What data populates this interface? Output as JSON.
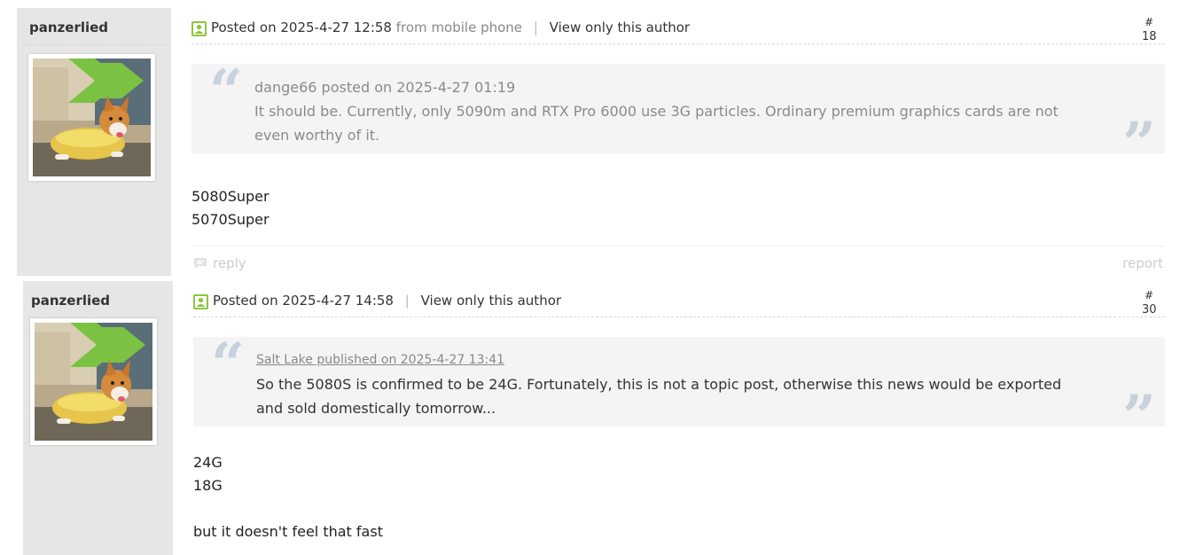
{
  "posts": [
    {
      "author": "panzerlied",
      "posted": "Posted on 2025-4-27 12:58",
      "from": "from mobile phone",
      "separator": "|",
      "view_only": "View only this author",
      "floor_mark": "#",
      "floor_num": "18",
      "quote": {
        "source": "dange66 posted on 2025-4-27 01:19",
        "text": "It should be. Currently, only 5090m and RTX Pro 6000 use 3G particles. Ordinary premium graphics cards are not even worthy of it."
      },
      "body_lines": [
        "5080Super",
        "5070Super"
      ],
      "reply": "reply",
      "report": "report"
    },
    {
      "author": "panzerlied",
      "posted": "Posted on 2025-4-27 14:58",
      "separator": "|",
      "view_only": "View only this author",
      "floor_mark": "#",
      "floor_num": "30",
      "quote": {
        "source": "Salt Lake published on 2025-4-27 13:41",
        "text": "So the 5080S is confirmed to be 24G. Fortunately, this is not a topic post, otherwise this news would be exported and sold domestically tomorrow..."
      },
      "body_lines": [
        "24G",
        "18G",
        "",
        "but it doesn't feel that fast"
      ]
    }
  ],
  "icons": {
    "user": "user-icon",
    "reply": "reply-icon",
    "quote_open": "“",
    "quote_close": "”"
  },
  "colors": {
    "sidebar_bg": "#e6e6e6",
    "quote_bg": "#f4f4f4",
    "user_icon_green": "#8cc63f"
  }
}
